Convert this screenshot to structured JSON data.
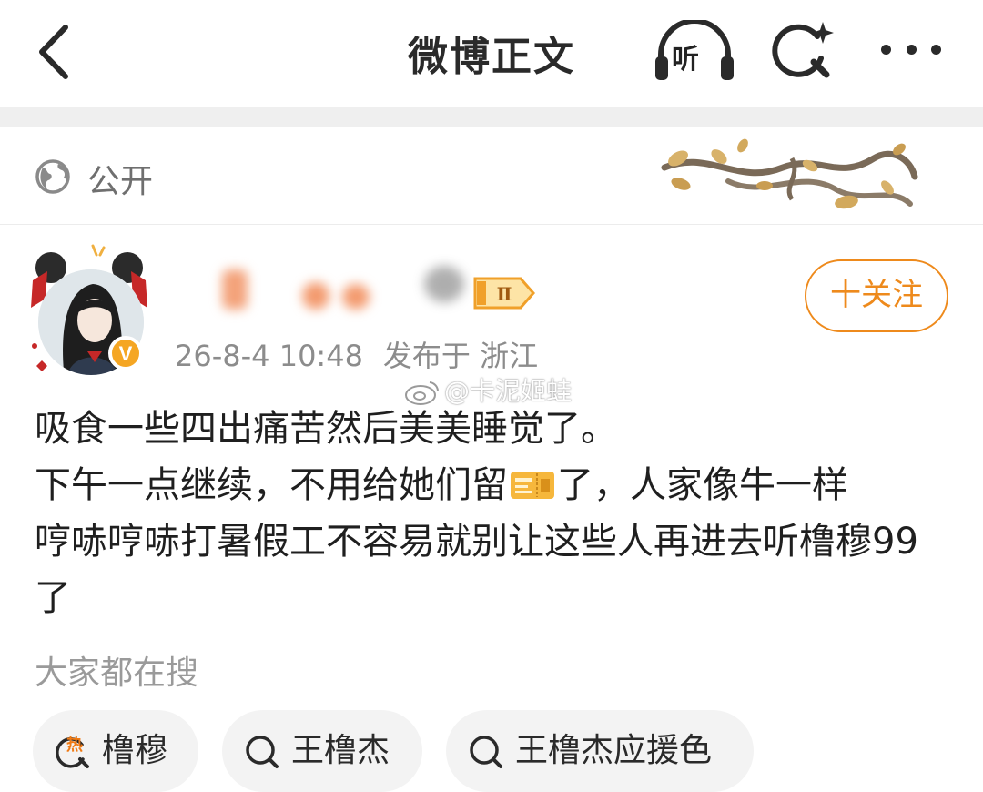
{
  "header": {
    "title": "微博正文",
    "back_icon": "chevron-left-icon",
    "listen_label": "听",
    "search_icon": "search-sparkle-icon",
    "more_icon": "more-dots-icon"
  },
  "visibility": {
    "label": "公开",
    "icon": "globe-icon"
  },
  "post": {
    "author_badge": "verified-v-badge",
    "level_badge": "Ⅱ",
    "follow_label": "十关注",
    "timestamp": "26-8-4 10:48",
    "location": "发布于 浙江",
    "watermark": "@卡泥姬蛙",
    "body_lines": [
      "吸食一些四出痛苦然后美美睡觉了。",
      "下午一点继续，不用给她们留",
      "了，人家像牛一样",
      "哼哧哼哧打暑假工不容易就别让这些人再进去听橹穆99了"
    ]
  },
  "trending": {
    "title": "大家都在搜",
    "chips": [
      {
        "label": "橹穆",
        "icon": "hot-search-icon"
      },
      {
        "label": "王橹杰",
        "icon": "search-icon"
      },
      {
        "label": "王橹杰应援色",
        "icon": "search-icon"
      }
    ]
  },
  "colors": {
    "accent": "#ee8a1c",
    "text_primary": "#1f1f1f",
    "text_secondary": "#8c8c8c"
  }
}
